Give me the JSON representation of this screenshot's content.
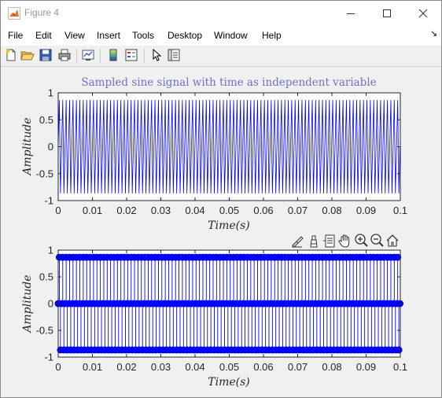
{
  "window": {
    "title": "Figure 4"
  },
  "menu": [
    "File",
    "Edit",
    "View",
    "Insert",
    "Tools",
    "Desktop",
    "Window",
    "Help"
  ],
  "menu_arrow": "↘",
  "toolbar": {
    "icons": [
      "new-figure-icon",
      "open-file-icon",
      "save-icon",
      "print-icon",
      "link-plot-icon",
      "colorbar-icon",
      "legend-icon",
      "pointer-icon",
      "property-inspector-icon"
    ]
  },
  "axes_toolbar": {
    "icons": [
      "brush-icon",
      "data-tips-icon",
      "edit-icon",
      "pan-icon",
      "zoom-in-icon",
      "zoom-out-icon",
      "home-icon"
    ]
  },
  "colors": {
    "signal": "#0000ff",
    "title": "#7070c8",
    "axes_text": "#262626"
  },
  "chart_data": [
    {
      "type": "line",
      "title": "Sampled sine signal with time as independent variable",
      "xlabel": "Time(s)",
      "ylabel": "Amplitude",
      "xlim": [
        0,
        0.1
      ],
      "ylim": [
        -1,
        1
      ],
      "xticks": [
        "0",
        "0.01",
        "0.02",
        "0.03",
        "0.04",
        "0.05",
        "0.06",
        "0.07",
        "0.08",
        "0.09",
        "0.1"
      ],
      "yticks": [
        "1",
        "0.5",
        "0",
        "-0.5",
        "-1"
      ],
      "series": [
        {
          "values_pattern": [
            0,
            0.866,
            -0.866
          ],
          "sample_step": 0.000333,
          "amplitude": 0.866
        }
      ],
      "grid": false
    },
    {
      "type": "stem",
      "title": "",
      "xlabel": "Time(s)",
      "ylabel": "Amplitude",
      "xlim": [
        0,
        0.1
      ],
      "ylim": [
        -1,
        1
      ],
      "xticks": [
        "0",
        "0.01",
        "0.02",
        "0.03",
        "0.04",
        "0.05",
        "0.06",
        "0.07",
        "0.08",
        "0.09",
        "0.1"
      ],
      "yticks": [
        "1",
        "0.5",
        "0",
        "-0.5",
        "-1"
      ],
      "series": [
        {
          "values_pattern": [
            0,
            0.866,
            -0.866
          ],
          "sample_step": 0.000333,
          "amplitude": 0.866
        }
      ],
      "grid": false
    }
  ]
}
